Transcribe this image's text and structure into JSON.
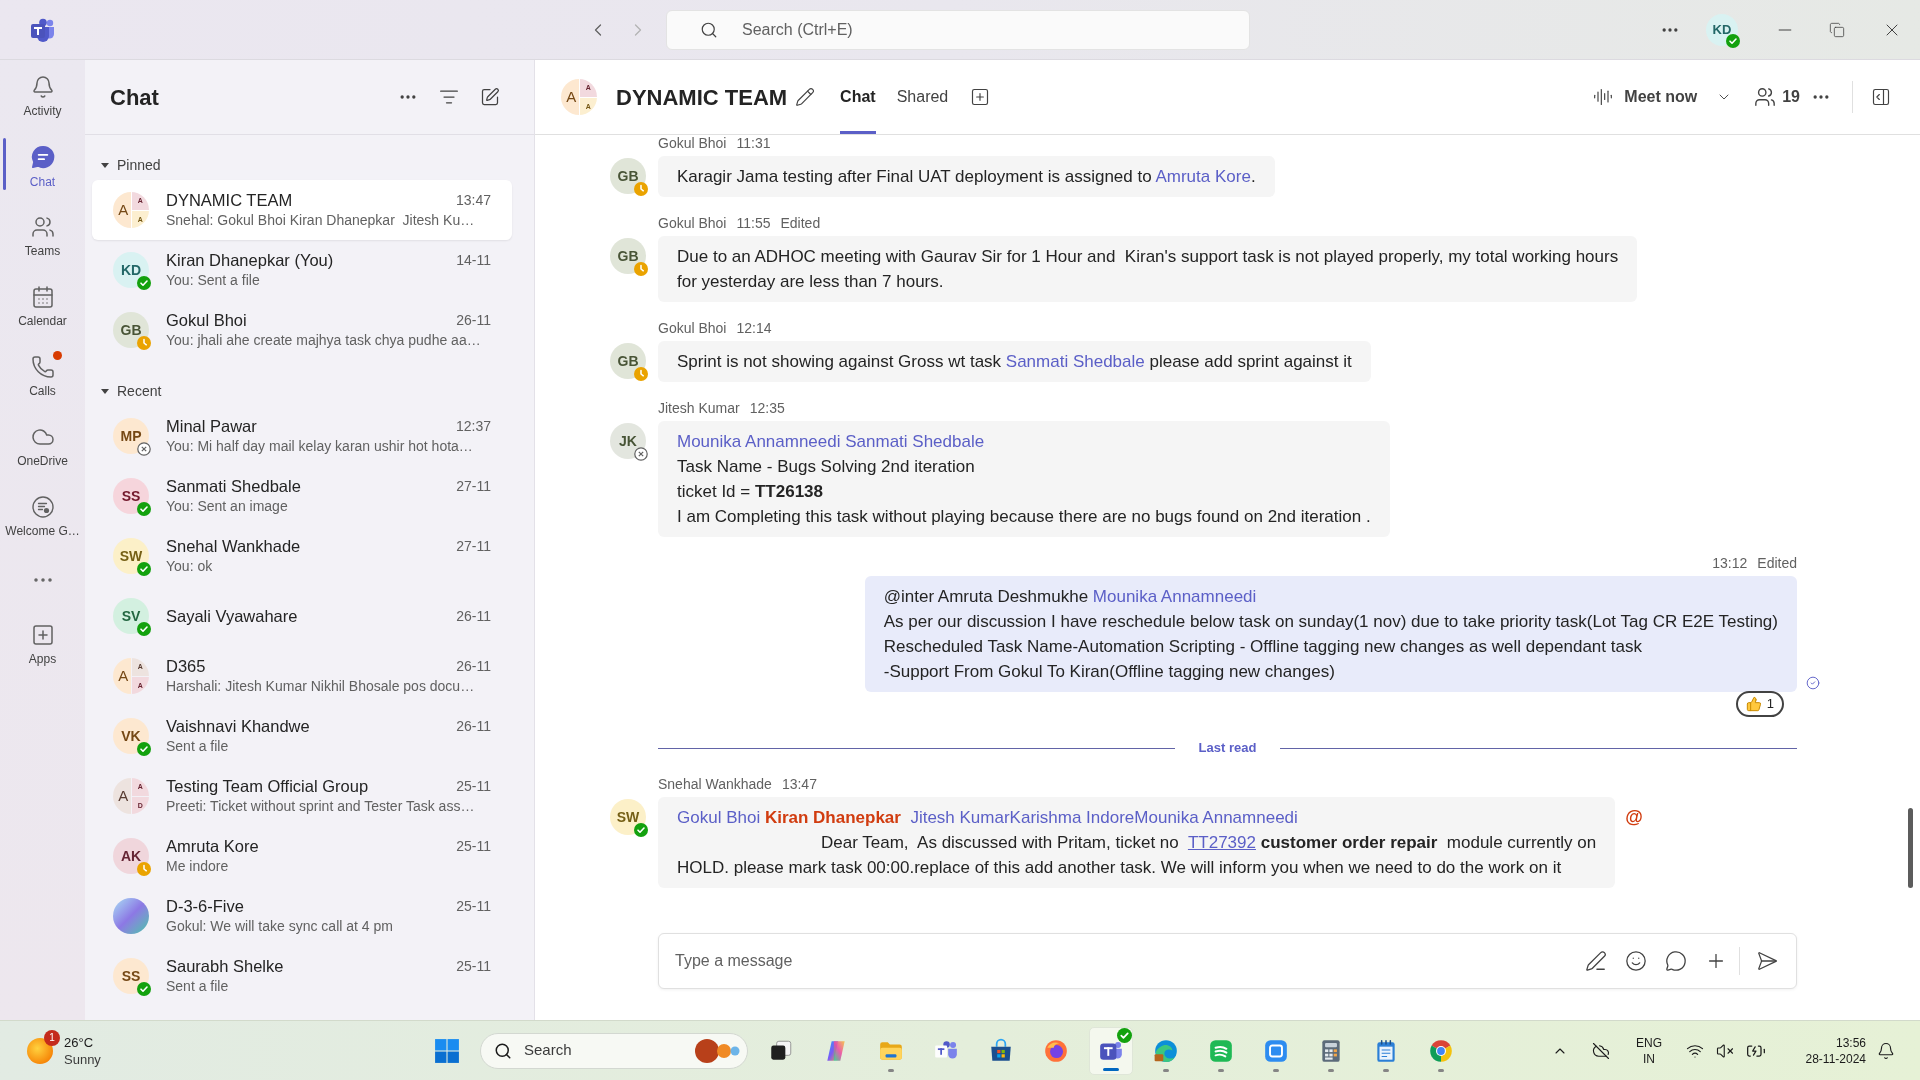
{
  "title_bar": {
    "search_placeholder": "Search (Ctrl+E)",
    "user": {
      "kind": "person",
      "initials": "KD",
      "color": "#d9f2f2",
      "presence": {
        "kind": "available"
      }
    }
  },
  "rail": [
    {
      "kind": "bell",
      "label": "Activity",
      "selected": false,
      "alert": false
    },
    {
      "kind": "chat",
      "label": "Chat",
      "selected": true,
      "alert": false
    },
    {
      "kind": "teams",
      "label": "Teams",
      "selected": false,
      "alert": false
    },
    {
      "kind": "calendar",
      "label": "Calendar",
      "selected": false,
      "alert": false
    },
    {
      "kind": "calls",
      "label": "Calls",
      "selected": false,
      "alert": true
    },
    {
      "kind": "cloud",
      "label": "OneDrive",
      "selected": false,
      "alert": false
    },
    {
      "kind": "welcome",
      "label": "Welcome G…",
      "selected": false,
      "alert": false
    },
    {
      "kind": "more",
      "selected": false,
      "alert": false
    },
    {
      "kind": "apps",
      "label": "Apps",
      "selected": false,
      "alert": false
    }
  ],
  "chat_list": {
    "title": "Chat",
    "sections": [
      {
        "title": "Pinned",
        "expanded": true,
        "items": [
          {
            "name": "DYNAMIC TEAM",
            "time": "13:47",
            "preview": "Snehal: Gokul Bhoi Kiran Dhanepkar  Jitesh Ku…",
            "selected": true,
            "avatar": {
              "kind": "group",
              "tiles": [
                {
                  "letter": "A",
                  "color": "#fde8d0"
                },
                {
                  "letter": "A",
                  "color": "#f2d9de"
                },
                {
                  "letter": "A",
                  "color": "#fcefd0"
                }
              ]
            }
          },
          {
            "name": "Kiran Dhanepkar (You)",
            "time": "14-11",
            "preview": "You: Sent a file",
            "selected": false,
            "avatar": {
              "kind": "person",
              "initials": "KD",
              "color": "#d9f2f2",
              "presence": {
                "kind": "available"
              }
            }
          },
          {
            "name": "Gokul Bhoi",
            "time": "26-11",
            "preview": "You: jhali ahe create majhya task chya pudhe aa…",
            "selected": false,
            "avatar": {
              "kind": "person",
              "initials": "GB",
              "color": "#e0e5d8",
              "presence": {
                "kind": "away"
              }
            }
          }
        ]
      },
      {
        "title": "Recent",
        "expanded": true,
        "items": [
          {
            "name": "Minal Pawar",
            "time": "12:37",
            "preview": "You: Mi half day mail kelay karan ushir hot hota…",
            "selected": false,
            "avatar": {
              "kind": "person",
              "initials": "MP",
              "color": "#fde8d0",
              "presence": {
                "kind": "offline"
              }
            }
          },
          {
            "name": "Sanmati Shedbale",
            "time": "27-11",
            "preview": "You: Sent an image",
            "selected": false,
            "avatar": {
              "kind": "person",
              "initials": "SS",
              "color": "#f6d5dc",
              "presence": {
                "kind": "available"
              }
            }
          },
          {
            "name": "Snehal Wankhade",
            "time": "27-11",
            "preview": "You: ok",
            "selected": false,
            "avatar": {
              "kind": "person",
              "initials": "SW",
              "color": "#fcf0c8",
              "presence": {
                "kind": "available"
              }
            }
          },
          {
            "name": "Sayali Vyawahare",
            "time": "26-11",
            "selected": false,
            "avatar": {
              "kind": "person",
              "initials": "SV",
              "color": "#d3f0e0",
              "presence": {
                "kind": "available"
              }
            }
          },
          {
            "name": "D365",
            "time": "26-11",
            "preview": "Harshali: Jitesh Kumar Nikhil Bhosale pos docu…",
            "selected": false,
            "avatar": {
              "kind": "group",
              "tiles": [
                {
                  "letter": "A",
                  "color": "#fde8d0"
                },
                {
                  "letter": "A",
                  "color": "#ede3df"
                },
                {
                  "letter": "A",
                  "color": "#f2d9de"
                }
              ]
            }
          },
          {
            "name": "Vaishnavi Khandwe",
            "time": "26-11",
            "preview": "Sent a file",
            "selected": false,
            "avatar": {
              "kind": "person",
              "initials": "VK",
              "color": "#fde8d0",
              "presence": {
                "kind": "available"
              }
            }
          },
          {
            "name": "Testing Team Official Group",
            "time": "25-11",
            "preview": "Preeti: Ticket without sprint and Tester Task ass…",
            "selected": false,
            "avatar": {
              "kind": "group",
              "tiles": [
                {
                  "letter": "A",
                  "color": "#ede3df"
                },
                {
                  "letter": "A",
                  "color": "#f2d9de"
                },
                {
                  "letter": "D",
                  "color": "#f2d9de"
                }
              ]
            }
          },
          {
            "name": "Amruta Kore",
            "time": "25-11",
            "preview": "Me indore",
            "selected": false,
            "avatar": {
              "kind": "person",
              "initials": "AK",
              "color": "#f0d6dc",
              "presence": {
                "kind": "away"
              }
            }
          },
          {
            "name": "D-3-6-Five",
            "time": "25-11",
            "preview": "Gokul: We will take sync call at 4 pm",
            "selected": false,
            "avatar": {
              "kind": "image"
            }
          },
          {
            "name": "Saurabh Shelke",
            "time": "25-11",
            "preview": "Sent a file",
            "selected": false,
            "avatar": {
              "kind": "person",
              "initials": "SS",
              "color": "#fde8d0",
              "presence": {
                "kind": "available"
              }
            }
          }
        ]
      }
    ]
  },
  "conversation": {
    "title": "DYNAMIC TEAM",
    "avatar": {
      "kind": "group",
      "tiles": [
        {
          "letter": "A",
          "color": "#fde8d0"
        },
        {
          "letter": "A",
          "color": "#f2d9de"
        },
        {
          "letter": "A",
          "color": "#fcefd0"
        }
      ]
    },
    "tabs": [
      {
        "label": "Chat",
        "selected": true
      },
      {
        "label": "Shared",
        "selected": false
      }
    ],
    "meet_label": "Meet now",
    "participants": "19"
  },
  "messages": [
    {
      "kind": "incoming",
      "sender": "Gokul Bhoi",
      "time": "11:31",
      "avatar": {
        "kind": "person",
        "initials": "GB",
        "color": "#e0e5d8",
        "presence": {
          "kind": "away"
        }
      },
      "lines": [
        {
          "parts": [
            {
              "kind": "text",
              "text": "Karagir Jama testing after Final UAT deployment is assigned to "
            },
            {
              "kind": "mention",
              "text": "Amruta Kore"
            },
            {
              "kind": "text",
              "text": "."
            }
          ]
        }
      ]
    },
    {
      "kind": "incoming",
      "sender": "Gokul Bhoi",
      "time": "11:55",
      "edited": "Edited",
      "avatar": {
        "kind": "person",
        "initials": "GB",
        "color": "#e0e5d8",
        "presence": {
          "kind": "away"
        }
      },
      "lines": [
        {
          "parts": [
            {
              "kind": "text",
              "text": "Due to an ADHOC meeting with Gaurav Sir for 1 Hour and  Kiran's support task is not played properly, my total working hours"
            }
          ]
        },
        {
          "parts": [
            {
              "kind": "text",
              "text": "for yesterday are less than 7 hours."
            }
          ]
        }
      ]
    },
    {
      "kind": "incoming",
      "sender": "Gokul Bhoi",
      "time": "12:14",
      "avatar": {
        "kind": "person",
        "initials": "GB",
        "color": "#e0e5d8",
        "presence": {
          "kind": "away"
        }
      },
      "lines": [
        {
          "parts": [
            {
              "kind": "text",
              "text": "Sprint is not showing against Gross wt task "
            },
            {
              "kind": "mention",
              "text": "Sanmati Shedbale"
            },
            {
              "kind": "text",
              "text": " please add sprint against it"
            }
          ]
        }
      ]
    },
    {
      "kind": "incoming",
      "sender": "Jitesh Kumar",
      "time": "12:35",
      "avatar": {
        "kind": "person",
        "initials": "JK",
        "color": "#e3e6df",
        "presence": {
          "kind": "offline"
        }
      },
      "lines": [
        {
          "parts": [
            {
              "kind": "mention",
              "text": "Mounika Annamneedi "
            },
            {
              "kind": "mention",
              "text": "Sanmati Shedbale"
            }
          ]
        },
        {
          "parts": [
            {
              "kind": "text",
              "text": "Task Name - Bugs Solving 2nd iteration"
            }
          ]
        },
        {
          "parts": [
            {
              "kind": "text",
              "text": "ticket Id = **TT26138**"
            }
          ]
        },
        {
          "parts": [
            {
              "kind": "text",
              "text": "I am Completing this task without playing because there are no bugs found on 2nd iteration ."
            }
          ]
        }
      ]
    },
    {
      "kind": "outgoing",
      "time": "13:12",
      "edited": "Edited",
      "read": true,
      "lines": [
        {
          "parts": [
            {
              "kind": "text",
              "text": "@inter Amruta Deshmukhe "
            },
            {
              "kind": "mention",
              "text": "Mounika Annamneedi"
            }
          ]
        },
        {
          "parts": [
            {
              "kind": "text",
              "text": "As per our discussion I have reschedule below task on sunday(1 nov) due to take priority task(Lot Tag CR E2E Testing)"
            }
          ]
        },
        {
          "parts": [
            {
              "kind": "text",
              "text": "Rescheduled Task Name-Automation Scripting - Offline tagging new changes as well dependant task"
            }
          ]
        },
        {
          "parts": [
            {
              "kind": "text",
              "text": "-Support From Gokul To Kiran(Offline tagging new changes)"
            }
          ]
        }
      ],
      "reactions": [
        {
          "kind": "thumbs_up",
          "count": "1"
        }
      ]
    },
    {
      "kind": "divider",
      "label": "Last read"
    },
    {
      "kind": "incoming",
      "sender": "Snehal Wankhade",
      "time": "13:47",
      "mention_mark": "@",
      "avatar": {
        "kind": "person",
        "initials": "SW",
        "color": "#fcf0c8",
        "presence": {
          "kind": "available"
        }
      },
      "lines": [
        {
          "parts": [
            {
              "kind": "mention",
              "text": "Gokul Bhoi "
            },
            {
              "kind": "self_mention",
              "text": "Kiran Dhanepkar  "
            },
            {
              "kind": "mention",
              "text": "Jitesh Kumar"
            },
            {
              "kind": "mention",
              "text": "Karishma Indore"
            },
            {
              "kind": "mention",
              "text": "Mounika Annamneedi"
            }
          ]
        },
        {
          "indent": true,
          "parts": [
            {
              "kind": "text",
              "text": "Dear Team,  As discussed with Pritam, ticket no  "
            },
            {
              "kind": "link",
              "text": "TT27392"
            },
            {
              "kind": "text",
              "text": " **customer order repair**  module currently on"
            }
          ]
        },
        {
          "parts": [
            {
              "kind": "text",
              "text": "HOLD. please mark task 00:00.replace of this add another task. We will inform you when we need to do the work on it"
            }
          ]
        }
      ]
    }
  ],
  "compose": {
    "placeholder": "Type a message"
  },
  "taskbar": {
    "weather": {
      "badge": "1",
      "temperature": "26°C",
      "condition": "Sunny"
    },
    "search_label": "Search",
    "apps": [
      {
        "kind": "task_view",
        "running": false,
        "selected": false,
        "badge": false
      },
      {
        "kind": "copilot",
        "running": false,
        "selected": false,
        "badge": false
      },
      {
        "kind": "folder",
        "running": true,
        "selected": false,
        "badge": false
      },
      {
        "kind": "teams_classic",
        "running": false,
        "selected": false,
        "badge": false
      },
      {
        "kind": "store",
        "running": false,
        "selected": false,
        "badge": false
      },
      {
        "kind": "firefox",
        "running": false,
        "selected": false,
        "badge": false
      },
      {
        "kind": "teams",
        "running": true,
        "selected": true,
        "badge": true
      },
      {
        "kind": "edge",
        "running": true,
        "selected": false,
        "badge": false
      },
      {
        "kind": "green_app",
        "running": true,
        "selected": false,
        "badge": false
      },
      {
        "kind": "blue_app",
        "running": true,
        "selected": false,
        "badge": false
      },
      {
        "kind": "calculator",
        "running": true,
        "selected": false,
        "badge": false
      },
      {
        "kind": "notepad",
        "running": true,
        "selected": false,
        "badge": false
      },
      {
        "kind": "chrome",
        "running": true,
        "selected": false,
        "badge": false
      }
    ],
    "language": [
      "ENG",
      "IN"
    ],
    "time": "13:56",
    "date": "28-11-2024"
  }
}
